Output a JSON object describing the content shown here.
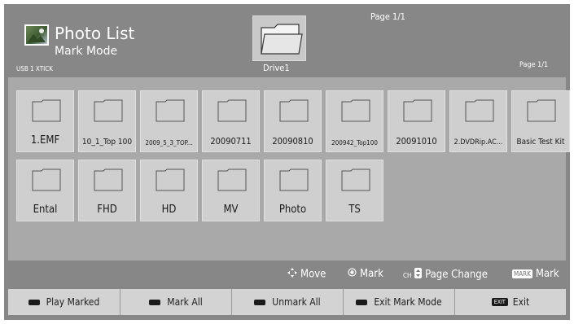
{
  "header": {
    "title": "Photo List",
    "subtitle": "Mark Mode",
    "device": "USB 1 XTICK",
    "page_indicator_top": "Page 1/1",
    "page_indicator_right": "Page 1/1",
    "current_folder": "Drive1"
  },
  "folders": [
    {
      "label": "1.EMF"
    },
    {
      "label": "10_1_Top 100"
    },
    {
      "label": "2009_5_3_TOP..."
    },
    {
      "label": "20090711"
    },
    {
      "label": "20090810"
    },
    {
      "label": "200942_Top100"
    },
    {
      "label": "20091010"
    },
    {
      "label": "2.DVDRip.AC..."
    },
    {
      "label": "Basic Test Kit"
    },
    {
      "label": "Ental"
    },
    {
      "label": "FHD"
    },
    {
      "label": "HD"
    },
    {
      "label": "MV"
    },
    {
      "label": "Photo"
    },
    {
      "label": "TS"
    }
  ],
  "hints": {
    "move": "Move",
    "mark": "Mark",
    "ch_tag": "CH",
    "page_change": "Page Change",
    "mark_tag": "MARK",
    "mark2": "Mark"
  },
  "buttons": {
    "play_marked": "Play Marked",
    "mark_all": "Mark All",
    "unmark_all": "Unmark All",
    "exit_mark_mode": "Exit Mark Mode",
    "exit_tag": "EXIT",
    "exit": "Exit"
  },
  "colors": {
    "background": "#878787",
    "panel": "#a9a9a9",
    "tile": "#cfcfcf",
    "button_bar": "#d3d3d3"
  }
}
